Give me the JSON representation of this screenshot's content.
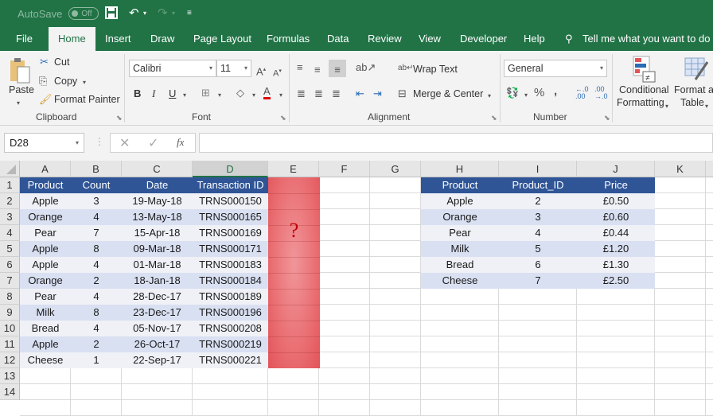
{
  "titlebar": {
    "autosave_label": "AutoSave",
    "autosave_state": "Off",
    "icons": [
      "save-icon",
      "undo-icon",
      "redo-icon",
      "customize-qat-icon"
    ]
  },
  "tabs": [
    {
      "label": "File"
    },
    {
      "label": "Home",
      "active": true
    },
    {
      "label": "Insert"
    },
    {
      "label": "Draw"
    },
    {
      "label": "Page Layout"
    },
    {
      "label": "Formulas"
    },
    {
      "label": "Data"
    },
    {
      "label": "Review"
    },
    {
      "label": "View"
    },
    {
      "label": "Developer"
    },
    {
      "label": "Help"
    }
  ],
  "tell_me": "Tell me what you want to do",
  "ribbon": {
    "clipboard": {
      "label": "Clipboard",
      "paste": "Paste",
      "cut": "Cut",
      "copy": "Copy",
      "format_painter": "Format Painter"
    },
    "font": {
      "label": "Font",
      "font_name": "Calibri",
      "font_size": "11",
      "bold": "B",
      "italic": "I",
      "underline": "U",
      "font_color": "#e00000"
    },
    "alignment": {
      "label": "Alignment",
      "wrap_text": "Wrap Text",
      "merge_center": "Merge & Center"
    },
    "number": {
      "label": "Number",
      "format": "General",
      "percent": "%",
      "comma": ","
    },
    "styles": {
      "conditional_formatting_1": "Conditional",
      "conditional_formatting_2": "Formatting",
      "format_as_table_1": "Format as",
      "format_as_table_2": "Table"
    }
  },
  "formula_bar": {
    "name_box": "D28",
    "fx": "fx",
    "value": ""
  },
  "columns": [
    "A",
    "B",
    "C",
    "D",
    "E",
    "F",
    "G",
    "H",
    "I",
    "J",
    "K"
  ],
  "selected_column": "D",
  "rows": [
    "1",
    "2",
    "3",
    "4",
    "5",
    "6",
    "7",
    "8",
    "9",
    "10",
    "11",
    "12",
    "13",
    "14"
  ],
  "transactions": {
    "headers": [
      "Product",
      "Count",
      "Date",
      "Transaction ID"
    ],
    "rows": [
      [
        "Apple",
        "3",
        "19-May-18",
        "TRNS000150"
      ],
      [
        "Orange",
        "4",
        "13-May-18",
        "TRNS000165"
      ],
      [
        "Pear",
        "7",
        "15-Apr-18",
        "TRNS000169"
      ],
      [
        "Apple",
        "8",
        "09-Mar-18",
        "TRNS000171"
      ],
      [
        "Apple",
        "4",
        "01-Mar-18",
        "TRNS000183"
      ],
      [
        "Orange",
        "2",
        "18-Jan-18",
        "TRNS000184"
      ],
      [
        "Pear",
        "4",
        "28-Dec-17",
        "TRNS000189"
      ],
      [
        "Milk",
        "8",
        "23-Dec-17",
        "TRNS000196"
      ],
      [
        "Bread",
        "4",
        "05-Nov-17",
        "TRNS000208"
      ],
      [
        "Apple",
        "2",
        "26-Oct-17",
        "TRNS000219"
      ],
      [
        "Cheese",
        "1",
        "22-Sep-17",
        "TRNS000221"
      ]
    ]
  },
  "question_column": {
    "text": "?",
    "color": "#e8676b"
  },
  "products": {
    "headers": [
      "Product",
      "Product_ID",
      "Price"
    ],
    "rows": [
      [
        "Apple",
        "2",
        "£0.50"
      ],
      [
        "Orange",
        "3",
        "£0.60"
      ],
      [
        "Pear",
        "4",
        "£0.44"
      ],
      [
        "Milk",
        "5",
        "£1.20"
      ],
      [
        "Bread",
        "6",
        "£1.30"
      ],
      [
        "Cheese",
        "7",
        "£2.50"
      ]
    ]
  },
  "colors": {
    "brand": "#217346",
    "table_header": "#2f5597",
    "band_light": "#eff1f6",
    "band_dark": "#d9e0f2"
  }
}
